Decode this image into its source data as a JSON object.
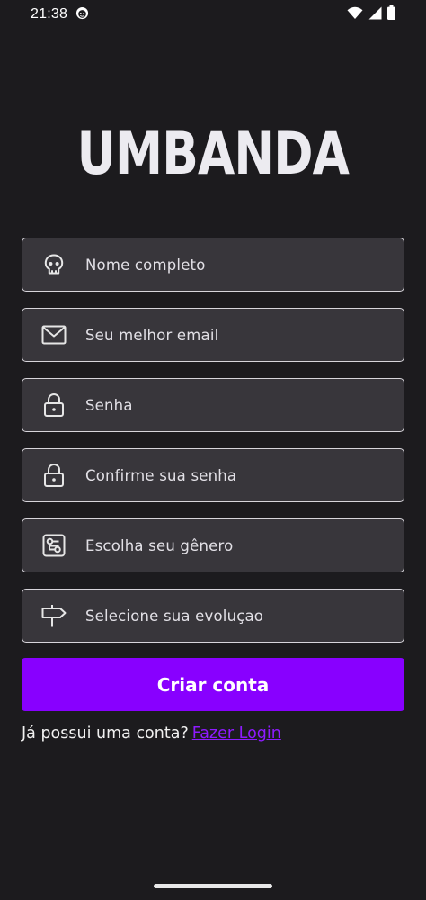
{
  "status_bar": {
    "time": "21:38",
    "icons": [
      "face-notification-icon",
      "wifi-icon",
      "signal-icon",
      "battery-icon"
    ]
  },
  "logo": {
    "text": "UMBANDA"
  },
  "form": {
    "fields": [
      {
        "placeholder": "Nome completo",
        "icon": "skull-icon"
      },
      {
        "placeholder": "Seu melhor email",
        "icon": "mail-icon"
      },
      {
        "placeholder": "Senha",
        "icon": "lock-icon"
      },
      {
        "placeholder": "Confirme sua senha",
        "icon": "lock-icon"
      },
      {
        "placeholder": "Escolha seu gênero",
        "icon": "gender-icon"
      },
      {
        "placeholder": "Selecione sua evoluçao",
        "icon": "signpost-icon"
      }
    ],
    "submit_label": "Criar conta"
  },
  "login_prompt": {
    "text": "Já possui uma conta?",
    "link": "Fazer Login"
  },
  "colors": {
    "background": "#1c1b1e",
    "field_background": "#38363b",
    "field_border": "#d7d5db",
    "accent": "#8800ff",
    "link": "#8e1bff"
  }
}
